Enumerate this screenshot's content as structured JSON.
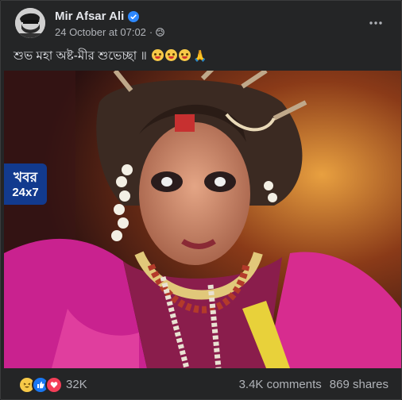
{
  "post": {
    "author": "Mir Afsar Ali",
    "timestamp": "24 October at 07:02",
    "separator": "·",
    "caption": "শুভ মহা অষ্ট-মীর শুভেচ্ছা ॥",
    "caption_emojis": [
      "grinning-squinting-tongue",
      "grinning-squinting-tongue",
      "grinning-squinting-tongue",
      "folded-hands"
    ],
    "more_icon": "more-horizontal-icon"
  },
  "media": {
    "logo_line1": "খবর",
    "logo_line2": "24x7"
  },
  "footer": {
    "reaction_icons": [
      "haha-icon",
      "like-icon",
      "love-icon"
    ],
    "reaction_count": "32K",
    "comments": "3.4K comments",
    "shares": "869 shares"
  },
  "colors": {
    "background": "#18191a",
    "card": "#242526",
    "verified": "#2d88ff",
    "logo_bg": "#123a8e"
  }
}
